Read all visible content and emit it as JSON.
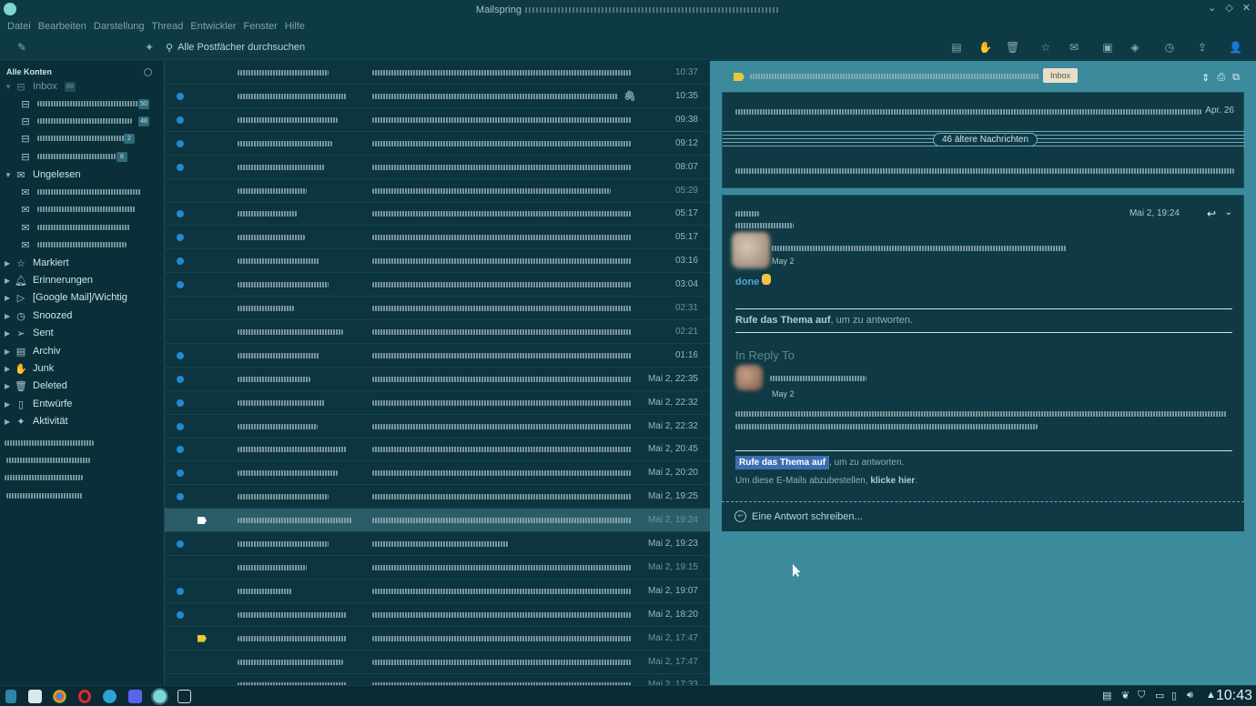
{
  "window": {
    "title": "Mailspring",
    "menu": [
      "Datei",
      "Bearbeiten",
      "Darstellung",
      "Thread",
      "Entwickler",
      "Fenster",
      "Hilfe"
    ]
  },
  "toolbar": {
    "search_placeholder": "Alle Postfächer durchsuchen",
    "icons": [
      "compose-icon",
      "activity-icon",
      "archive-icon",
      "spam-icon",
      "trash-icon",
      "star-icon",
      "mark-unread-icon",
      "move-to-folder-icon",
      "label-icon",
      "snooze-icon",
      "share-icon",
      "account-icon"
    ]
  },
  "sidebar": {
    "header": "Alle Konten",
    "inbox": {
      "label": "Inbox",
      "count": "68"
    },
    "inbox_sub_counts": [
      "50",
      "48",
      "2",
      "8"
    ],
    "unread": {
      "label": "Ungelesen"
    },
    "folders": [
      "Markiert",
      "Erinnerungen",
      "[Google Mail]/Wichtig",
      "Snoozed",
      "Sent",
      "Archiv",
      "Junk",
      "Deleted",
      "Entwürfe",
      "Aktivität"
    ]
  },
  "messages": [
    {
      "time": "10:37",
      "unread": false
    },
    {
      "time": "10:35",
      "unread": true,
      "attachment": true
    },
    {
      "time": "09:38",
      "unread": true
    },
    {
      "time": "09:12",
      "unread": true
    },
    {
      "time": "08:07",
      "unread": true
    },
    {
      "time": "05:29",
      "unread": false
    },
    {
      "time": "05:17",
      "unread": true
    },
    {
      "time": "05:17",
      "unread": true
    },
    {
      "time": "03:16",
      "unread": true
    },
    {
      "time": "03:04",
      "unread": true
    },
    {
      "time": "02:31",
      "unread": false
    },
    {
      "time": "02:21",
      "unread": false
    },
    {
      "time": "01:16",
      "unread": true
    },
    {
      "time": "Mai 2, 22:35",
      "unread": true
    },
    {
      "time": "Mai 2, 22:32",
      "unread": true
    },
    {
      "time": "Mai 2, 22:32",
      "unread": true
    },
    {
      "time": "Mai 2, 20:45",
      "unread": true
    },
    {
      "time": "Mai 2, 20:20",
      "unread": true
    },
    {
      "time": "Mai 2, 19:25",
      "unread": true
    },
    {
      "time": "Mai 2, 19:24",
      "unread": false,
      "selected": true,
      "tag": "white"
    },
    {
      "time": "Mai 2, 19:23",
      "unread": true
    },
    {
      "time": "Mai 2, 19:15",
      "unread": false
    },
    {
      "time": "Mai 2, 19:07",
      "unread": true
    },
    {
      "time": "Mai 2, 18:20",
      "unread": true
    },
    {
      "time": "Mai 2, 17:47",
      "unread": false,
      "tag": "yellow"
    },
    {
      "time": "Mai 2, 17:47",
      "unread": false
    },
    {
      "time": "Mai 2, 17:33",
      "unread": false
    }
  ],
  "reader": {
    "label_chip": "Inbox",
    "card1_date": "Apr. 26",
    "older_messages": "46 ältere Nachrichten",
    "message_date": "Mai 2, 19:24",
    "sender_date": "May 2",
    "body_done": "done",
    "cta_bold": "Rufe das Thema auf",
    "cta_rest": ", um zu antworten.",
    "in_reply_to": "In Reply To",
    "quoted_date": "May 2",
    "cta2_bold": "Rufe das Thema auf",
    "cta2_rest": ", um zu antworten.",
    "unsubscribe_text": "Um diese E-Mails abzubestellen,",
    "unsubscribe_link": "klicke hier",
    "unsubscribe_dot": ".",
    "reply_placeholder": "Eine Antwort schreiben..."
  },
  "taskbar": {
    "clock": "10:43"
  },
  "colors": {
    "unread_dot": "#1f8ad2",
    "reader_bg": "#3b8b9d",
    "list_bg": "#0d3540",
    "flag_yellow": "#e6c93a"
  }
}
